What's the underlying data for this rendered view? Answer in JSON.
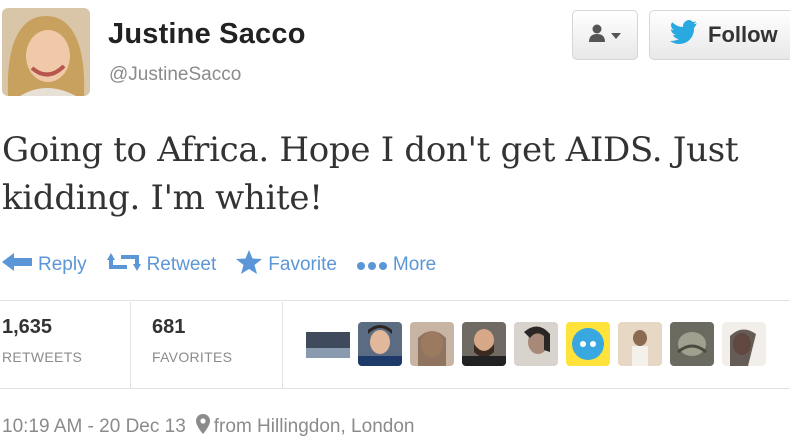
{
  "user": {
    "name": "Justine Sacco",
    "handle": "@JustineSacco"
  },
  "buttons": {
    "follow_label": "Follow"
  },
  "tweet": {
    "text": "Going to Africa. Hope I don't get AIDS. Just kidding. I'm white!"
  },
  "actions": [
    {
      "label": "Reply",
      "icon": "reply-icon"
    },
    {
      "label": "Retweet",
      "icon": "retweet-icon"
    },
    {
      "label": "Favorite",
      "icon": "star-icon"
    },
    {
      "label": "More",
      "icon": "more-dots-icon"
    }
  ],
  "stats": {
    "retweets": {
      "count": "1,635",
      "label": "RETWEETS"
    },
    "favorites": {
      "count": "681",
      "label": "FAVORITES"
    }
  },
  "footer": {
    "timestamp": "10:19 AM - 20 Dec 13",
    "location": "from Hillingdon, London"
  },
  "colors": {
    "link_blue": "#5b96d6",
    "twitter_bird": "#2aa9e0",
    "muted_gray": "#8b8b8b"
  }
}
